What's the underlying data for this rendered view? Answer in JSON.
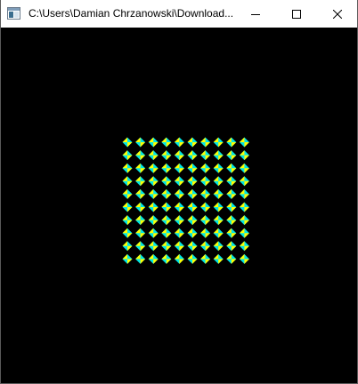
{
  "window": {
    "title": "C:\\Users\\Damian Chrzanowski\\Download...",
    "icon": "console-app-icon",
    "buttons": {
      "minimize": "minimize-icon",
      "maximize": "maximize-icon",
      "close": "close-icon"
    }
  },
  "canvas": {
    "background": "#000000",
    "pattern": {
      "rows": 10,
      "columns": 10,
      "colors": {
        "yellow": "#ffff00",
        "cyan": "#00e5e5"
      }
    }
  }
}
